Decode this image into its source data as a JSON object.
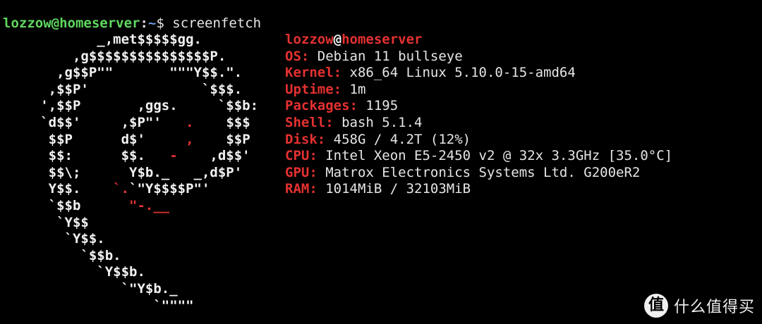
{
  "prompt": {
    "user_host": "lozzow@homeserver",
    "separator": ":",
    "path": "~",
    "symbol": "$",
    "command": " screenfetch"
  },
  "logo_lines": [
    [
      [
        "w",
        "            _,met$$$$$gg."
      ]
    ],
    [
      [
        "w",
        "         ,g$$$$$$$$$$$$$$$P."
      ]
    ],
    [
      [
        "w",
        "       ,g$$P\"\"       \"\"\"Y$$.\"."
      ]
    ],
    [
      [
        "w",
        "      ,$$P'              `$$$."
      ]
    ],
    [
      [
        "w",
        "     ',$$P       ,ggs.     `$$b:"
      ]
    ],
    [
      [
        "w",
        "     `d$$'     ,$P\"'   "
      ],
      [
        "r",
        "."
      ],
      [
        "w",
        "    $$$"
      ]
    ],
    [
      [
        "w",
        "      $$P      d$'     "
      ],
      [
        "r",
        ","
      ],
      [
        "w",
        "    $$P"
      ]
    ],
    [
      [
        "w",
        "      $$:      $$.   "
      ],
      [
        "r",
        "-"
      ],
      [
        "w",
        "    ,d$$'"
      ]
    ],
    [
      [
        "w",
        "      $$\\;      Y$b._   _,d$P'"
      ]
    ],
    [
      [
        "w",
        "      Y$$.    "
      ],
      [
        "r",
        "`."
      ],
      [
        "w",
        "`\"Y$$$$P\"'"
      ]
    ],
    [
      [
        "w",
        "      `$$b      "
      ],
      [
        "r",
        "\"-.__"
      ]
    ],
    [
      [
        "w",
        "       `Y$$"
      ]
    ],
    [
      [
        "w",
        "        `Y$$."
      ]
    ],
    [
      [
        "w",
        "          `$$b."
      ]
    ],
    [
      [
        "w",
        "            `Y$$b."
      ]
    ],
    [
      [
        "w",
        "               `\"Y$b._"
      ]
    ],
    [
      [
        "w",
        "                   `\"\"\"\""
      ]
    ]
  ],
  "info": {
    "user": "lozzow",
    "at": "@",
    "host": "homeserver",
    "lines": [
      {
        "key": "OS:",
        "value": " Debian 11 bullseye"
      },
      {
        "key": "Kernel:",
        "value": " x86_64 Linux 5.10.0-15-amd64"
      },
      {
        "key": "Uptime:",
        "value": " 1m"
      },
      {
        "key": "Packages:",
        "value": " 1195"
      },
      {
        "key": "Shell:",
        "value": " bash 5.1.4"
      },
      {
        "key": "Disk:",
        "value": " 458G / 4.2T (12%)"
      },
      {
        "key": "CPU:",
        "value": " Intel Xeon E5-2450 v2 @ 32x 3.3GHz [35.0°C]"
      },
      {
        "key": "GPU:",
        "value": " Matrox Electronics Systems Ltd. G200eR2"
      },
      {
        "key": "RAM:",
        "value": " 1014MiB / 32103MiB"
      }
    ]
  },
  "watermark": {
    "icon_char": "值",
    "text": "什么值得买"
  },
  "colors": {
    "background": "#000000",
    "prompt_user": "#5fd75f",
    "prompt_path": "#6f9be8",
    "accent_red": "#e53131",
    "text": "#e6e6e6"
  }
}
